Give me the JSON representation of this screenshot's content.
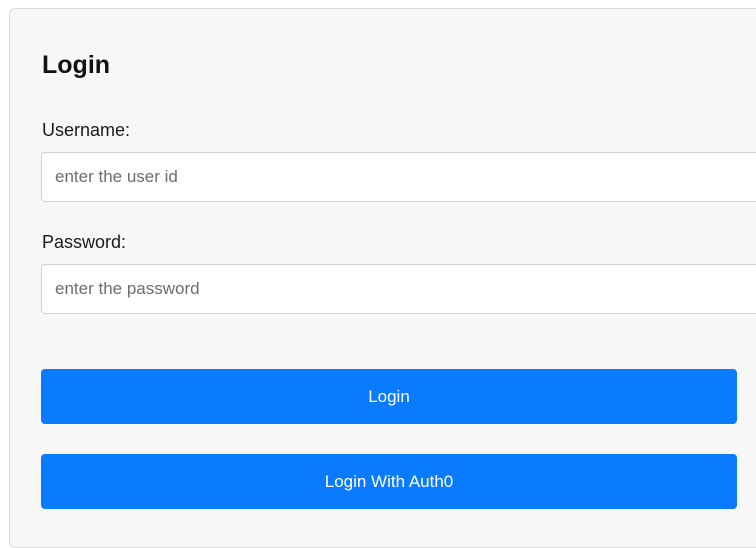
{
  "form": {
    "title": "Login",
    "username_label": "Username:",
    "username_placeholder": "enter the user id",
    "username_value": "",
    "password_label": "Password:",
    "password_placeholder": "enter the password",
    "password_value": "",
    "login_button_label": "Login",
    "auth0_button_label": "Login With Auth0"
  },
  "colors": {
    "accent": "#0a7bff",
    "card_background": "#f7f7f7"
  }
}
